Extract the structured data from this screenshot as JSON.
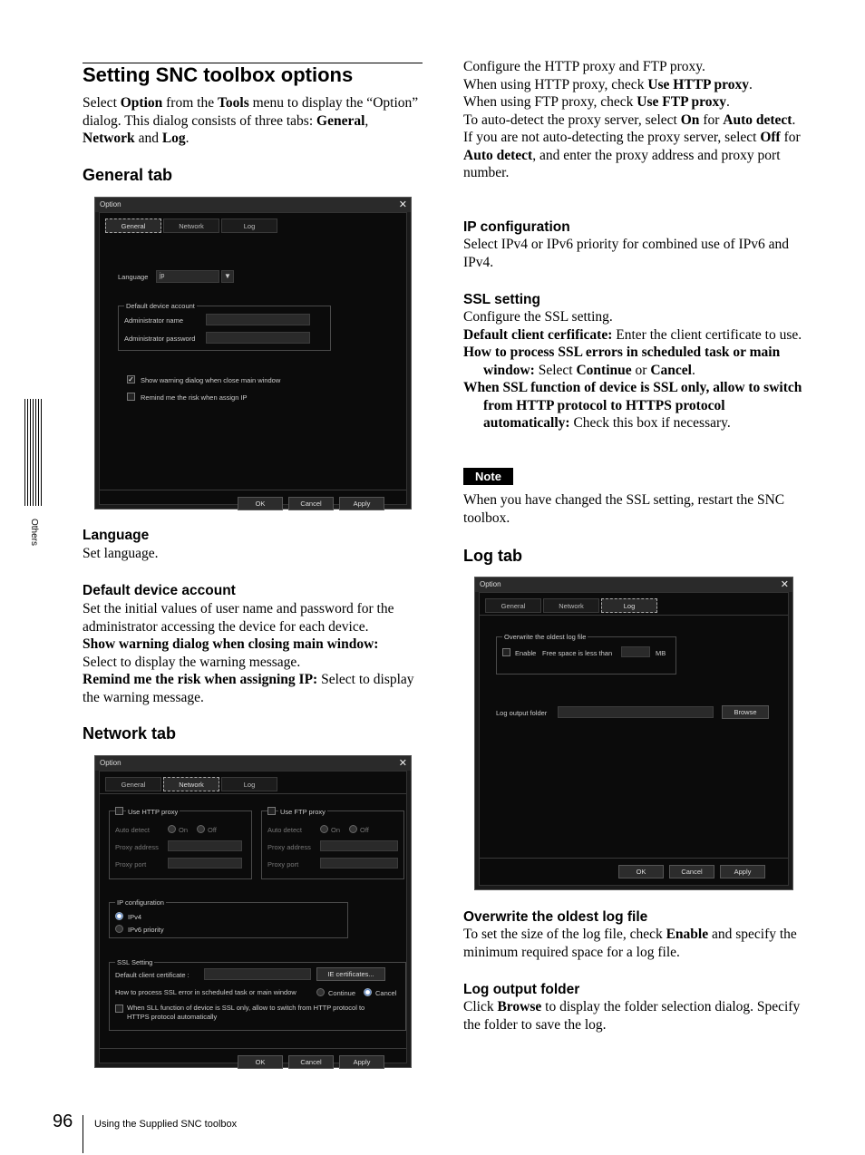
{
  "page": {
    "title": "Setting SNC toolbox options",
    "intro_1": "Select ",
    "intro_option": "Option",
    "intro_2": " from the ",
    "intro_tools": "Tools",
    "intro_3": " menu to display the “Option” dialog. This dialog consists of three tabs: ",
    "intro_general": "General",
    "intro_comma": ", ",
    "intro_network": "Network",
    "intro_and": " and ",
    "intro_log": "Log",
    "intro_end": ".",
    "side_label": "Others",
    "page_number": "96",
    "footer_text": "Using the Supplied SNC toolbox"
  },
  "general_section": {
    "heading": "General tab",
    "language_heading": "Language",
    "language_text": "Set language.",
    "account_heading": "Default device account",
    "account_text": "Set the initial values of user name and password for the administrator accessing the device for each device.",
    "warn_bold": "Show warning dialog when closing main window:",
    "warn_text": "Select to display the warning message.",
    "remind_bold": "Remind me the risk when assigning IP:",
    "remind_text": " Select to display the warning message."
  },
  "network_section": {
    "heading": "Network tab",
    "p1": "Configure the HTTP proxy and FTP proxy.",
    "p2a": "When using HTTP proxy, check ",
    "p2b": "Use HTTP proxy",
    "p2c": ".",
    "p3a": "When using FTP proxy, check ",
    "p3b": "Use FTP proxy",
    "p3c": ".",
    "p4a": "To auto-detect the proxy server, select ",
    "p4b": "On",
    "p4c": " for ",
    "p4d": "Auto detect",
    "p4e": ".",
    "p5a": "If you are not auto-detecting the proxy server, select ",
    "p5b": "Off",
    "p5c": " for ",
    "p5d": "Auto detect",
    "p5e": ", and enter the proxy address and proxy port number.",
    "ip_heading": "IP configuration",
    "ip_text": "Select IPv4 or IPv6 priority for combined use of IPv6 and IPv4.",
    "ssl_heading": "SSL setting",
    "ssl_text": "Configure the SSL setting.",
    "ssl_cert_bold": "Default client cerfificate:",
    "ssl_cert_text": " Enter the client certificate to use.",
    "ssl_err_bold": "How to process SSL errors in scheduled task or main window:",
    "ssl_err_a": " Select ",
    "ssl_err_b": "Continue",
    "ssl_err_c": " or ",
    "ssl_err_d": "Cancel",
    "ssl_err_e": ".",
    "ssl_only_bold": "When SSL function of device is SSL only, allow to switch from HTTP protocol to HTTPS protocol automatically:",
    "ssl_only_text": " Check this box if necessary.",
    "note_label": "Note",
    "note_text": "When you have changed the SSL setting, restart the SNC toolbox."
  },
  "log_section": {
    "heading": "Log tab",
    "overwrite_heading": "Overwrite the oldest log file",
    "overwrite_a": "To set the size of the log file, check ",
    "overwrite_b": "Enable",
    "overwrite_c": " and specify the minimum required space for a log file.",
    "folder_heading": "Log output folder",
    "folder_a": "Click ",
    "folder_b": "Browse",
    "folder_c": " to display the folder selection dialog. Specify the folder to save the log."
  },
  "dialog": {
    "title": "Option",
    "close": "✕",
    "tabs": [
      "General",
      "Network",
      "Log"
    ],
    "ok": "OK",
    "cancel": "Cancel",
    "apply": "Apply"
  },
  "general_dialog": {
    "language_label": "Language",
    "language_value": "jp",
    "account_group": "Default device account",
    "admin_name": "Administrator name",
    "admin_password": "Administrator password",
    "show_warning": "Show warning dialog when close main window",
    "show_warning_checked": true,
    "remind": "Remind me the risk when assign IP",
    "remind_checked": false
  },
  "network_dialog": {
    "use_http": "Use HTTP proxy",
    "use_ftp": "Use FTP proxy",
    "auto_detect": "Auto detect",
    "on": "On",
    "off": "Off",
    "proxy_address": "Proxy address",
    "proxy_port": "Proxy port",
    "ip_group": "IP configuration",
    "ipv4": "IPv4",
    "ipv6": "IPv6 priority",
    "ssl_group": "SSL Setting",
    "client_cert": "Default client certificate :",
    "ie_button": "IE certificates...",
    "ssl_error": "How to process SSL error in scheduled task or main window",
    "continue": "Continue",
    "cancel_opt": "Cancel",
    "ssl_only_1": "When SLL function of device is SSL only, allow to switch from HTTP protocol to",
    "ssl_only_2": "HTTPS protocol automatically"
  },
  "log_dialog": {
    "overwrite_group": "Overwrite the oldest log file",
    "enable": "Enable",
    "free_space": "Free space is less than",
    "mb": "MB",
    "output_folder": "Log output folder",
    "browse": "Browse"
  }
}
